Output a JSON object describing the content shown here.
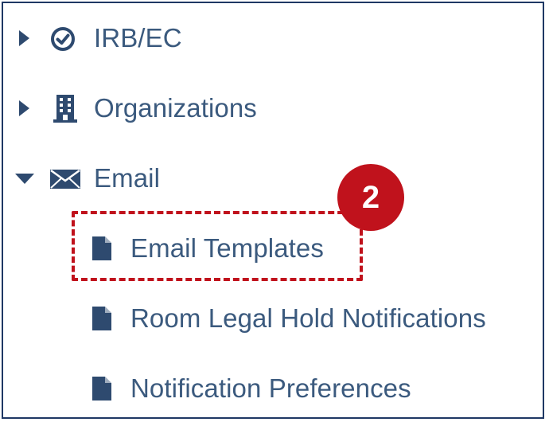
{
  "nav": {
    "items": [
      {
        "label": "IRB/EC",
        "expanded": false,
        "icon": "check-circle-icon"
      },
      {
        "label": "Organizations",
        "expanded": false,
        "icon": "building-icon"
      },
      {
        "label": "Email",
        "expanded": true,
        "icon": "envelope-icon",
        "children": [
          {
            "label": "Email Templates",
            "icon": "document-icon",
            "highlighted": true
          },
          {
            "label": "Room Legal Hold Notifications",
            "icon": "document-icon"
          },
          {
            "label": "Notification Preferences",
            "icon": "document-icon"
          }
        ]
      }
    ]
  },
  "callout": {
    "step": "2"
  },
  "colors": {
    "text": "#3b5a7e",
    "icon": "#2e4a6f",
    "highlight": "#c0121c",
    "frame": "#1f3864"
  }
}
